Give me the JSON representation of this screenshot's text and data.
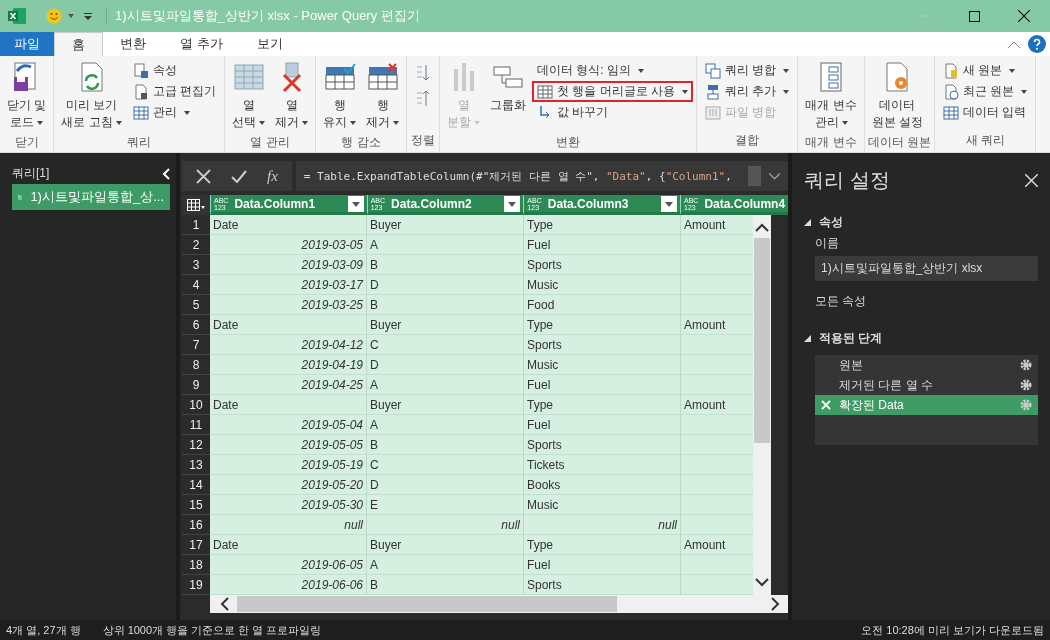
{
  "window": {
    "title": "1)시트및파일통합_상반기 xlsx - Power Query 편집기"
  },
  "tabs": [
    {
      "label": "파일",
      "kind": "file",
      "selected": false
    },
    {
      "label": "홈",
      "kind": "tab",
      "selected": true
    },
    {
      "label": "변환",
      "kind": "tab",
      "selected": false
    },
    {
      "label": "열 추가",
      "kind": "tab",
      "selected": false
    },
    {
      "label": "보기",
      "kind": "tab",
      "selected": false
    }
  ],
  "ribbon": [
    {
      "label": "닫기",
      "items": [
        {
          "kind": "large",
          "label": "닫기 및\n로드",
          "dropdown": true,
          "disabled": false
        }
      ]
    },
    {
      "label": "쿼리",
      "items": [
        {
          "kind": "large",
          "label": "미리 보기\n새로 고침",
          "dropdown": true,
          "disabled": false
        },
        {
          "kind": "stack",
          "entries": [
            {
              "label": "속성",
              "dropdown": false,
              "disabled": false
            },
            {
              "label": "고급 편집기",
              "dropdown": false,
              "disabled": false
            },
            {
              "label": "관리",
              "dropdown": true,
              "disabled": false
            }
          ]
        }
      ]
    },
    {
      "label": "열 관리",
      "items": [
        {
          "kind": "large",
          "label": "열\n선택",
          "dropdown": true,
          "disabled": false
        },
        {
          "kind": "large",
          "label": "열\n제거",
          "dropdown": true,
          "disabled": false
        }
      ]
    },
    {
      "label": "행 감소",
      "items": [
        {
          "kind": "large",
          "label": "행\n유지",
          "dropdown": true,
          "disabled": false
        },
        {
          "kind": "large",
          "label": "행\n제거",
          "dropdown": true,
          "disabled": false
        }
      ]
    },
    {
      "label": "정렬",
      "items": [
        {
          "kind": "sort"
        }
      ]
    },
    {
      "label": "변환",
      "items": [
        {
          "kind": "large",
          "label": "열\n분할",
          "dropdown": true,
          "disabled": true
        },
        {
          "kind": "large",
          "label": "그룹화",
          "dropdown": false,
          "disabled": false
        },
        {
          "kind": "stack",
          "entries": [
            {
              "label": "데이터 형식: 임의",
              "dropdown": true,
              "disabled": false,
              "highlighted": false
            },
            {
              "label": "첫 행을 머리글로 사용",
              "dropdown": true,
              "disabled": false,
              "highlighted": true
            },
            {
              "label": "값 바꾸기",
              "dropdown": false,
              "disabled": false,
              "highlighted": false
            }
          ]
        }
      ]
    },
    {
      "label": "결합",
      "items": [
        {
          "kind": "stack",
          "entries": [
            {
              "label": "쿼리 병합",
              "dropdown": true,
              "disabled": false
            },
            {
              "label": "쿼리 추가",
              "dropdown": true,
              "disabled": false
            },
            {
              "label": "파일 병합",
              "dropdown": false,
              "disabled": true
            }
          ]
        }
      ]
    },
    {
      "label": "매개 변수",
      "items": [
        {
          "kind": "large",
          "label": "매개 변수\n관리",
          "dropdown": true,
          "disabled": false
        }
      ]
    },
    {
      "label": "데이터 원본",
      "items": [
        {
          "kind": "large",
          "label": "데이터\n원본 설정",
          "dropdown": false,
          "disabled": false
        }
      ]
    },
    {
      "label": "새 쿼리",
      "items": [
        {
          "kind": "stack",
          "entries": [
            {
              "label": "새 원본",
              "dropdown": true,
              "disabled": false
            },
            {
              "label": "최근 원본",
              "dropdown": true,
              "disabled": false
            },
            {
              "label": "데이터 입력",
              "dropdown": false,
              "disabled": false
            }
          ]
        }
      ]
    }
  ],
  "queries": {
    "title": "쿼리[1]",
    "items": [
      {
        "label": "1)시트및파일통합_상...",
        "selected": true
      }
    ]
  },
  "formula_bar": {
    "fx": "fx",
    "tokens": [
      {
        "text": "= Table.ExpandTableColumn(#\"제거된 다른 열 수\", ",
        "kind": "code"
      },
      {
        "text": "\"Data\"",
        "kind": "string"
      },
      {
        "text": ", {",
        "kind": "code"
      },
      {
        "text": "\"Column1\"",
        "kind": "string"
      },
      {
        "text": ",",
        "kind": "code"
      }
    ]
  },
  "table": {
    "columns": [
      {
        "name": "Data.Column1",
        "type": [
          "ABC",
          "123"
        ],
        "filter": true
      },
      {
        "name": "Data.Column2",
        "type": [
          "ABC",
          "123"
        ],
        "filter": true
      },
      {
        "name": "Data.Column3",
        "type": [
          "ABC",
          "123"
        ],
        "filter": true
      },
      {
        "name": "Data.Column4",
        "type": [
          "ABC",
          "123"
        ]
      }
    ],
    "rows": [
      {
        "number": "1",
        "cells": [
          {
            "text": "Date",
            "kind": "text"
          },
          {
            "text": "Buyer",
            "kind": "text"
          },
          {
            "text": "Type",
            "kind": "text"
          },
          {
            "text": "Amount",
            "kind": "text"
          }
        ]
      },
      {
        "number": "2",
        "cells": [
          {
            "text": "2019-03-05",
            "kind": "value"
          },
          {
            "text": "A",
            "kind": "text"
          },
          {
            "text": "Fuel",
            "kind": "text"
          }
        ]
      },
      {
        "number": "3",
        "cells": [
          {
            "text": "2019-03-09",
            "kind": "value"
          },
          {
            "text": "B",
            "kind": "text"
          },
          {
            "text": "Sports",
            "kind": "text"
          }
        ]
      },
      {
        "number": "4",
        "cells": [
          {
            "text": "2019-03-17",
            "kind": "value"
          },
          {
            "text": "D",
            "kind": "text"
          },
          {
            "text": "Music",
            "kind": "text"
          }
        ]
      },
      {
        "number": "5",
        "cells": [
          {
            "text": "2019-03-25",
            "kind": "value"
          },
          {
            "text": "B",
            "kind": "text"
          },
          {
            "text": "Food",
            "kind": "text"
          }
        ]
      },
      {
        "number": "6",
        "cells": [
          {
            "text": "Date",
            "kind": "text"
          },
          {
            "text": "Buyer",
            "kind": "text"
          },
          {
            "text": "Type",
            "kind": "text"
          },
          {
            "text": "Amount",
            "kind": "text"
          }
        ]
      },
      {
        "number": "7",
        "cells": [
          {
            "text": "2019-04-12",
            "kind": "value"
          },
          {
            "text": "C",
            "kind": "text"
          },
          {
            "text": "Sports",
            "kind": "text"
          }
        ]
      },
      {
        "number": "8",
        "cells": [
          {
            "text": "2019-04-19",
            "kind": "value"
          },
          {
            "text": "D",
            "kind": "text"
          },
          {
            "text": "Music",
            "kind": "text"
          }
        ]
      },
      {
        "number": "9",
        "cells": [
          {
            "text": "2019-04-25",
            "kind": "value"
          },
          {
            "text": "A",
            "kind": "text"
          },
          {
            "text": "Fuel",
            "kind": "text"
          }
        ]
      },
      {
        "number": "10",
        "cells": [
          {
            "text": "Date",
            "kind": "text"
          },
          {
            "text": "Buyer",
            "kind": "text"
          },
          {
            "text": "Type",
            "kind": "text"
          },
          {
            "text": "Amount",
            "kind": "text"
          }
        ]
      },
      {
        "number": "11",
        "cells": [
          {
            "text": "2019-05-04",
            "kind": "value"
          },
          {
            "text": "A",
            "kind": "text"
          },
          {
            "text": "Fuel",
            "kind": "text"
          }
        ]
      },
      {
        "number": "12",
        "cells": [
          {
            "text": "2019-05-05",
            "kind": "value"
          },
          {
            "text": "B",
            "kind": "text"
          },
          {
            "text": "Sports",
            "kind": "text"
          }
        ]
      },
      {
        "number": "13",
        "cells": [
          {
            "text": "2019-05-19",
            "kind": "value"
          },
          {
            "text": "C",
            "kind": "text"
          },
          {
            "text": "Tickets",
            "kind": "text"
          }
        ]
      },
      {
        "number": "14",
        "cells": [
          {
            "text": "2019-05-20",
            "kind": "value"
          },
          {
            "text": "D",
            "kind": "text"
          },
          {
            "text": "Books",
            "kind": "text"
          }
        ]
      },
      {
        "number": "15",
        "cells": [
          {
            "text": "2019-05-30",
            "kind": "value"
          },
          {
            "text": "E",
            "kind": "text"
          },
          {
            "text": "Music",
            "kind": "text"
          }
        ]
      },
      {
        "number": "16",
        "cells": [
          {
            "text": "null",
            "kind": "value"
          },
          {
            "text": "null",
            "kind": "value"
          },
          {
            "text": "null",
            "kind": "value"
          }
        ]
      },
      {
        "number": "17",
        "cells": [
          {
            "text": "Date",
            "kind": "text"
          },
          {
            "text": "Buyer",
            "kind": "text"
          },
          {
            "text": "Type",
            "kind": "text"
          },
          {
            "text": "Amount",
            "kind": "text"
          }
        ]
      },
      {
        "number": "18",
        "cells": [
          {
            "text": "2019-06-05",
            "kind": "value"
          },
          {
            "text": "A",
            "kind": "text"
          },
          {
            "text": "Fuel",
            "kind": "text"
          }
        ]
      },
      {
        "number": "19",
        "cells": [
          {
            "text": "2019-06-06",
            "kind": "value"
          },
          {
            "text": "B",
            "kind": "text"
          },
          {
            "text": "Sports",
            "kind": "text"
          }
        ]
      }
    ]
  },
  "settings": {
    "title": "쿼리 설정",
    "properties": {
      "heading": "속성",
      "expanded": true,
      "name_label": "이름",
      "name_value": "1)시트및파일통합_상반기 xlsx",
      "all_properties": "모든 속성"
    },
    "steps": {
      "heading": "적용된 단계",
      "expanded": true,
      "items": [
        {
          "label": "원본",
          "selected": false
        },
        {
          "label": "제거된 다른 열 수",
          "selected": false
        },
        {
          "label": "확장된 Data",
          "selected": true
        }
      ]
    }
  },
  "status_bar": {
    "left": [
      "4개 열, 27개 행",
      "상위 1000개 행을 기준으로 한 열 프로파일링"
    ],
    "right": "오전 10:28에 미리 보기가 다운로드됨"
  }
}
